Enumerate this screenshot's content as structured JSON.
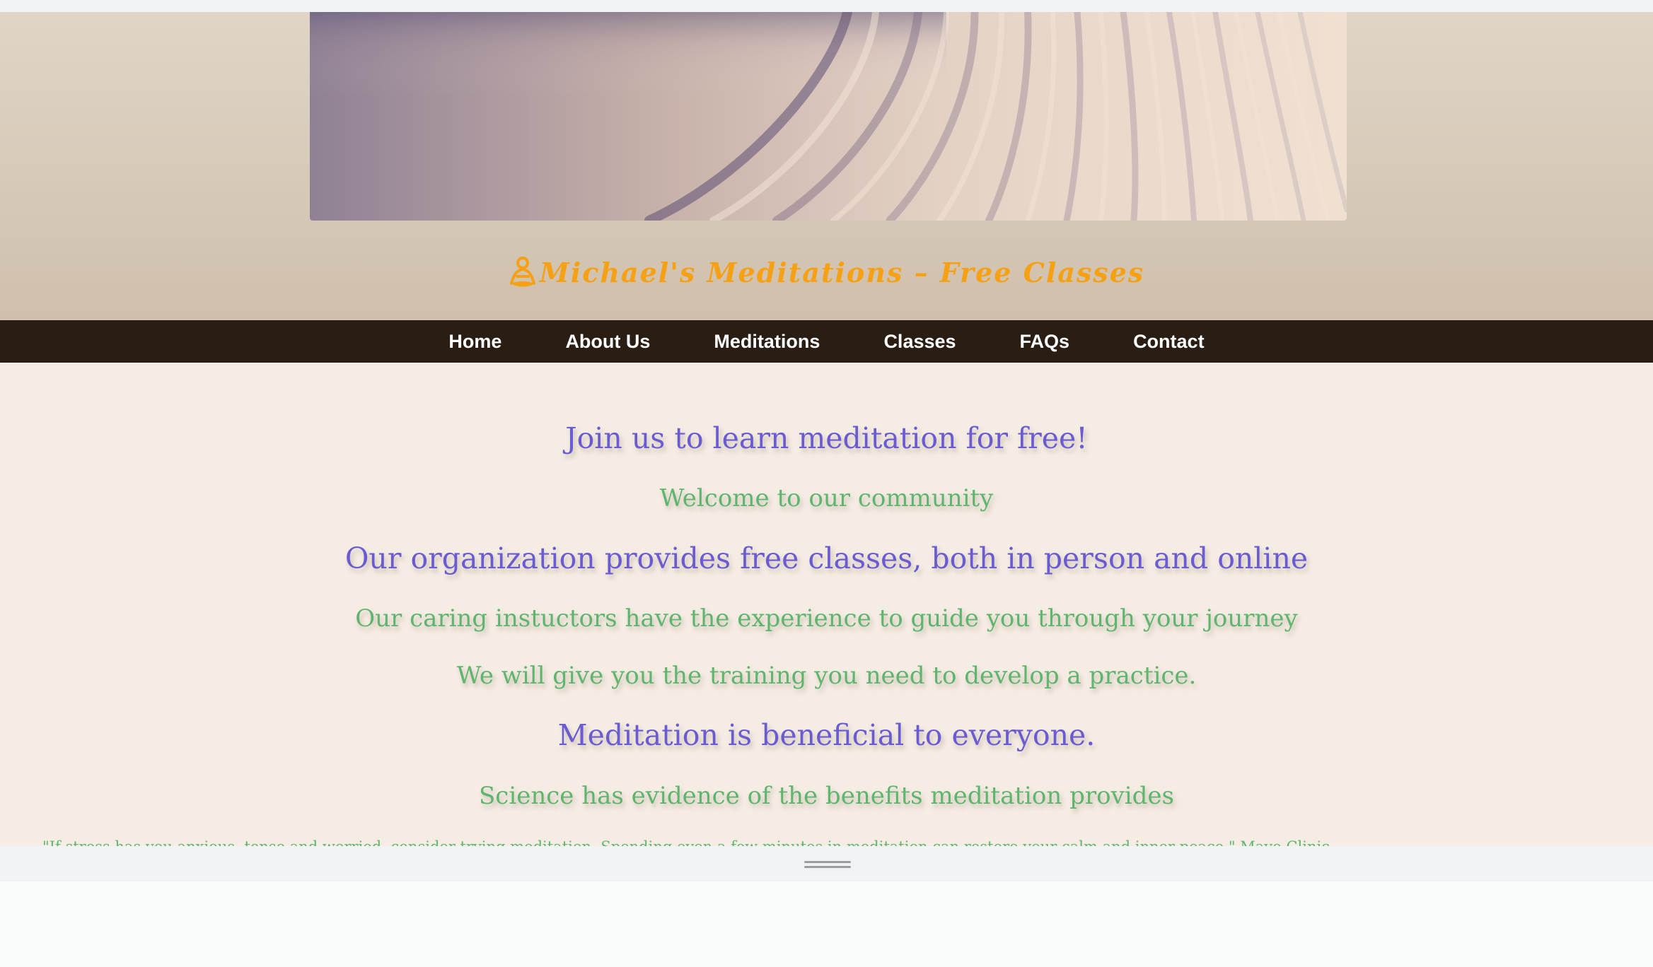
{
  "site": {
    "title": "Michael's Meditations – Free Classes",
    "logo_icon": "meditation-person-icon",
    "title_color": "#f6a014"
  },
  "nav": {
    "items": [
      "Home",
      "About Us",
      "Meditations",
      "Classes",
      "FAQs",
      "Contact"
    ]
  },
  "main": {
    "lines": [
      {
        "text": "Join us to learn meditation for free!",
        "style": "purple"
      },
      {
        "text": "Welcome to our community",
        "style": "green"
      },
      {
        "text": "Our organization provides free classes, both in person and online",
        "style": "purple"
      },
      {
        "text": "Our caring instuctors have the experience to guide you through your journey",
        "style": "green"
      },
      {
        "text": "We will give you the training you need to develop a practice.",
        "style": "green"
      },
      {
        "text": "Meditation is beneficial to everyone.",
        "style": "purple"
      },
      {
        "text": "Science has evidence of the benefits meditation provides",
        "style": "green"
      }
    ],
    "quote": "\"If stress has you anxious, tense and worried, consider trying meditation. Spending even a few minutes in meditation can restore your calm and inner peace.\" Mayo Clinic"
  },
  "colors": {
    "accent_purple": "#6b5bd2",
    "accent_green": "#5fb56d",
    "nav_background": "#2a1e14",
    "content_background": "#f5ede4"
  }
}
